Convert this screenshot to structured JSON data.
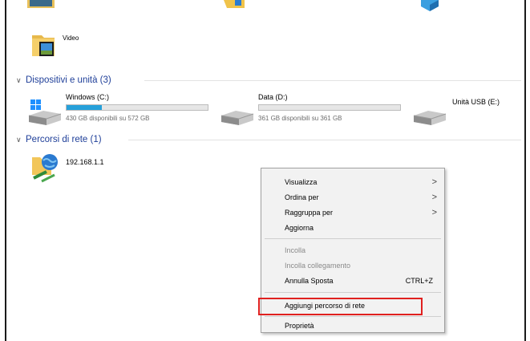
{
  "folders": {
    "video_label": "Video"
  },
  "sections": {
    "devices": {
      "label": "Dispositivi e unità (3)"
    },
    "network": {
      "label": "Percorsi di rete (1)"
    }
  },
  "drives": [
    {
      "name": "Windows (C:)",
      "space": "430 GB disponibili su 572 GB",
      "used_fraction": 0.25
    },
    {
      "name": "Data (D:)",
      "space": "361 GB disponibili su 361 GB",
      "used_fraction": 0.0
    },
    {
      "name": "Unità USB (E:)"
    }
  ],
  "network_locations": [
    {
      "name": "192.168.1.1"
    }
  ],
  "context_menu": {
    "items": [
      {
        "label": "Visualizza",
        "submenu": true
      },
      {
        "label": "Ordina per",
        "submenu": true
      },
      {
        "label": "Raggruppa per",
        "submenu": true
      },
      {
        "label": "Aggiorna"
      },
      {
        "label": "Incolla",
        "disabled": true
      },
      {
        "label": "Incolla collegamento",
        "disabled": true
      },
      {
        "label": "Annulla Sposta",
        "shortcut": "CTRL+Z"
      },
      {
        "label": "Aggiungi percorso di rete",
        "highlighted": true
      },
      {
        "label": "Proprietà"
      }
    ],
    "submenu_glyph": ">"
  },
  "colors": {
    "accent": "#1f3f99",
    "drive_fill": "#26a0da",
    "highlight_border": "#e0201f"
  }
}
